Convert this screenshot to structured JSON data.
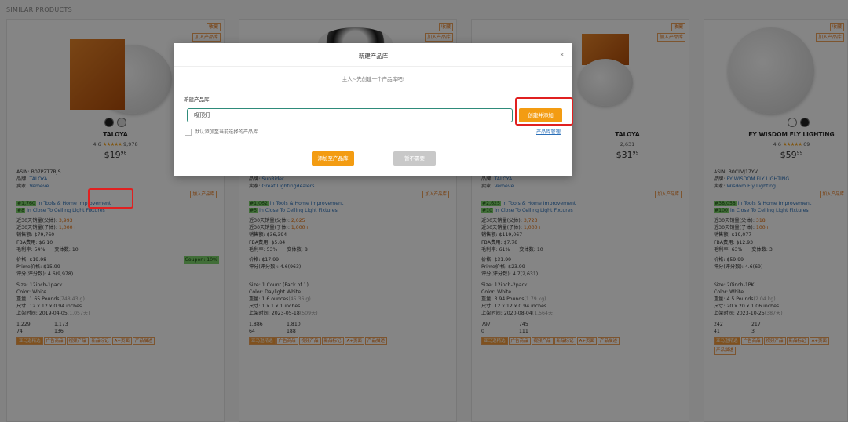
{
  "page_title": "SIMILAR PRODUCTS",
  "common": {
    "asin_label": "ASIN:",
    "brand_label": "品牌:",
    "seller_label": "卖家:",
    "sales_parent_label": "近30天销量(父体):",
    "sales_child_label": "近30天销量(子体):",
    "revenue_label": "销售额:",
    "fba_label": "FBA费用:",
    "margin_label": "毛利率:",
    "variants_label": "变体数:",
    "price_label": "价格:",
    "prime_price_label": "Prime价格:",
    "reviews_label": "评分(评分数):",
    "size_label": "Size:",
    "color_label": "Color:",
    "weight_label": "重量:",
    "dimensions_label": "尺寸:",
    "launch_label": "上架时间:",
    "add_to_library": "加入产品库",
    "collect_label": "收藏",
    "main_category": "in Tools & Home Improvement",
    "sub_category": "in Close To Ceiling Light Fixtures"
  },
  "cards": [
    {
      "brand": "TALOYA",
      "rating": "4.6",
      "stars": "★★★★★",
      "review_count": "9,978",
      "price_main": "$19",
      "price_cents": "98",
      "asin": "B07PZT7RJS",
      "brand_value": "TALOYA",
      "seller": "Vemeve",
      "main_rank": "#1,760",
      "sub_rank": "#8",
      "sales_parent": "3,993",
      "sales_child": "1,000+",
      "revenue": "$79,760",
      "fba": "$6.10",
      "margin": "54%",
      "variants": "10",
      "price": "$19.98",
      "coupon": "Coupon: 10%",
      "prime_price": "$15.99",
      "reviews": "4.6(9,978)",
      "size": "12inch-1pack",
      "color": "White",
      "weight": "1.65 Pounds",
      "weight_note": "(748.43 g)",
      "dimensions": "12 x 12 x 0.94 inches",
      "launch": "2019-04-05",
      "launch_note": "(1,057天)",
      "stats": [
        "1,229",
        "1,173",
        "74",
        "136"
      ],
      "tags": [
        "亚马逊精选",
        "广告商品",
        "视频产品",
        "新品标记",
        "A+页面",
        "产品描述"
      ]
    },
    {
      "brand": "",
      "rating": "",
      "stars": "",
      "review_count": "",
      "price_main": "",
      "price_cents": "",
      "asin": "",
      "brand_value": "SunRider",
      "seller": "Great Lightingdealers",
      "main_rank": "#1,062",
      "sub_rank": "#5",
      "sales_parent": "2,025",
      "sales_child": "1,000+",
      "revenue": "$36,394",
      "fba": "$5.84",
      "margin": "53%",
      "variants": "8",
      "price": "$17.99",
      "coupon": "",
      "prime_price": "",
      "reviews": "4.6(963)",
      "size": "1 Count (Pack of 1)",
      "color": "Daylight White",
      "weight": "1.6 ounces",
      "weight_note": "(45.36 g)",
      "dimensions": "1 x 1 x 1 inches",
      "launch": "2023-05-18",
      "launch_note": "(509天)",
      "stats": [
        "1,886",
        "1,810",
        "64",
        "188"
      ],
      "tags": [
        "亚马逊精选",
        "广告商品",
        "视频产品",
        "新品标记",
        "A+页面",
        "产品描述"
      ]
    },
    {
      "brand": "TALOYA",
      "rating": "",
      "stars": "",
      "review_count": "2,631",
      "price_main": "$31",
      "price_cents": "99",
      "asin": "",
      "brand_value": "TALOYA",
      "seller": "Vemeve",
      "main_rank": "#2,625",
      "sub_rank": "#10",
      "sales_parent": "3,723",
      "sales_child": "1,000+",
      "revenue": "$119,067",
      "fba": "$7.78",
      "margin": "61%",
      "variants": "10",
      "price": "$31.99",
      "coupon": "",
      "prime_price": "$23.99",
      "reviews": "4.7(2,631)",
      "size": "12inch-2pack",
      "color": "White",
      "weight": "3.94 Pounds",
      "weight_note": "(1.79 kg)",
      "dimensions": "12 x 12 x 0.94 inches",
      "launch": "2020-08-04",
      "launch_note": "(1,564天)",
      "stats": [
        "797",
        "745",
        "0",
        "111"
      ],
      "tags": [
        "亚马逊精选",
        "广告商品",
        "视频产品",
        "新品标记",
        "A+页面",
        "产品描述"
      ]
    },
    {
      "brand": "FY WISDOM FLY LIGHTING",
      "rating": "4.6",
      "stars": "★★★★★",
      "review_count": "69",
      "price_main": "$59",
      "price_cents": "99",
      "asin": "B0CLVJ17YV",
      "brand_value": "FY WISDOM FLY LIGHTING",
      "seller": "Wisdom Fly Lighting",
      "main_rank": "#38,058",
      "sub_rank": "#100",
      "sales_parent": "318",
      "sales_child": "100+",
      "revenue": "$19,077",
      "fba": "$12.93",
      "margin": "63%",
      "variants": "3",
      "price": "$59.99",
      "coupon": "",
      "prime_price": "",
      "reviews": "4.6(69)",
      "size": "20inch-1PK",
      "color": "White",
      "weight": "4.5 Pounds",
      "weight_note": "(2.04 kg)",
      "dimensions": "20 x 20 x 1.06 inches",
      "launch": "2023-10-25",
      "launch_note": "(387天)",
      "stats": [
        "242",
        "217",
        "41",
        "3"
      ],
      "tags": [
        "亚马逊精选",
        "广告商品",
        "视频产品",
        "新品标记",
        "A+页面",
        "产品描述"
      ]
    }
  ],
  "modal": {
    "title": "新建产品库",
    "close": "×",
    "subtitle": "主人~先创建一个产品库吧!",
    "field_label": "新建产品库",
    "input_value": "吸顶灯",
    "create_button": "创建并添加",
    "checkbox_label": "默认添加至当前选择的产品库",
    "manage_link": "产品库管理",
    "add_button": "添加至产品库",
    "skip_button": "暂不需要"
  },
  "colors": {
    "accent": "#f39c12",
    "highlight": "#e02020",
    "input_border": "#2e8b7a"
  }
}
